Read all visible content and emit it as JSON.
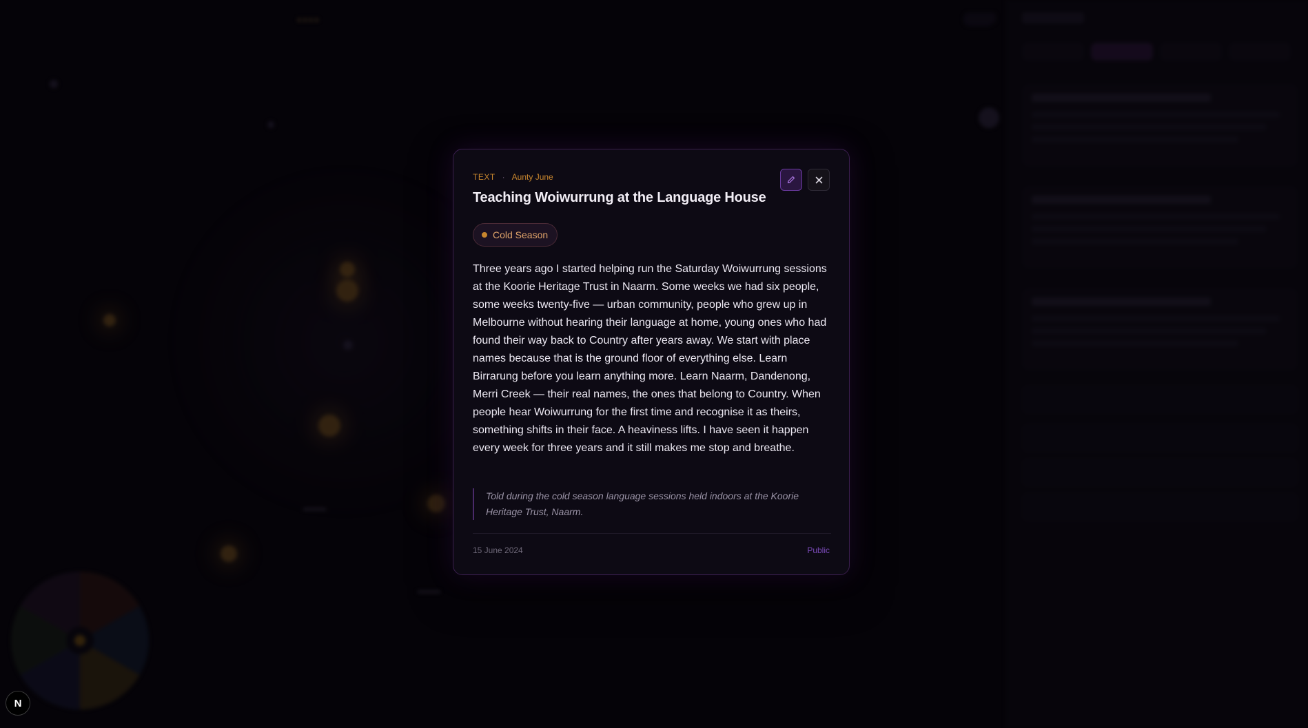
{
  "modal": {
    "type": "TEXT",
    "separator": "·",
    "author": "Aunty June",
    "title": "Teaching Woiwurrung at the Language House",
    "season": "Cold Season",
    "body": "Three years ago I started helping run the Saturday Woiwurrung sessions at the Koorie Heritage Trust in Naarm. Some weeks we had six people, some weeks twenty-five — urban community, people who grew up in Melbourne without hearing their language at home, young ones who had found their way back to Country after years away. We start with place names because that is the ground floor of everything else. Learn Birrarung before you learn anything more. Learn Naarm, Dandenong, Merri Creek — their real names, the ones that belong to Country. When people hear Woiwurrung for the first time and recognise it as theirs, something shifts in their face. A heaviness lifts. I have seen it happen every week for three years and it still makes me stop and breathe.",
    "context_note": "Told during the cold season language sessions held indoors at the Koorie Heritage Trust, Naarm.",
    "date": "15 June 2024",
    "visibility": "Public",
    "icons": {
      "edit": "pencil-icon",
      "close": "close-icon"
    }
  },
  "badge": {
    "letter": "N"
  },
  "colors": {
    "accent_amber": "#c8862e",
    "accent_purple": "#7a4ab8",
    "modal_border": "#3a1e4e",
    "background": "#070509"
  }
}
